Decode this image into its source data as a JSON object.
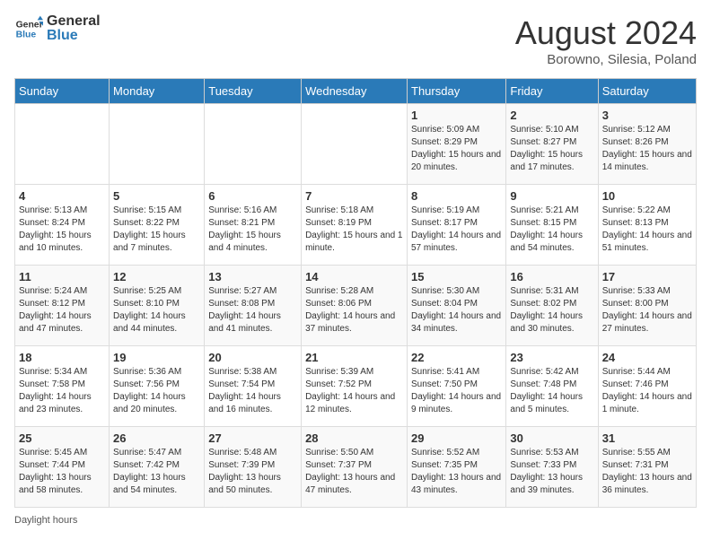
{
  "logo": {
    "general": "General",
    "blue": "Blue"
  },
  "header": {
    "title": "August 2024",
    "subtitle": "Borowno, Silesia, Poland"
  },
  "days_of_week": [
    "Sunday",
    "Monday",
    "Tuesday",
    "Wednesday",
    "Thursday",
    "Friday",
    "Saturday"
  ],
  "weeks": [
    [
      {
        "day": "",
        "sunrise": "",
        "sunset": "",
        "daylight": "",
        "empty": true
      },
      {
        "day": "",
        "sunrise": "",
        "sunset": "",
        "daylight": "",
        "empty": true
      },
      {
        "day": "",
        "sunrise": "",
        "sunset": "",
        "daylight": "",
        "empty": true
      },
      {
        "day": "",
        "sunrise": "",
        "sunset": "",
        "daylight": "",
        "empty": true
      },
      {
        "day": "1",
        "sunrise": "5:09 AM",
        "sunset": "8:29 PM",
        "daylight": "15 hours and 20 minutes."
      },
      {
        "day": "2",
        "sunrise": "5:10 AM",
        "sunset": "8:27 PM",
        "daylight": "15 hours and 17 minutes."
      },
      {
        "day": "3",
        "sunrise": "5:12 AM",
        "sunset": "8:26 PM",
        "daylight": "15 hours and 14 minutes."
      }
    ],
    [
      {
        "day": "4",
        "sunrise": "5:13 AM",
        "sunset": "8:24 PM",
        "daylight": "15 hours and 10 minutes."
      },
      {
        "day": "5",
        "sunrise": "5:15 AM",
        "sunset": "8:22 PM",
        "daylight": "15 hours and 7 minutes."
      },
      {
        "day": "6",
        "sunrise": "5:16 AM",
        "sunset": "8:21 PM",
        "daylight": "15 hours and 4 minutes."
      },
      {
        "day": "7",
        "sunrise": "5:18 AM",
        "sunset": "8:19 PM",
        "daylight": "15 hours and 1 minute."
      },
      {
        "day": "8",
        "sunrise": "5:19 AM",
        "sunset": "8:17 PM",
        "daylight": "14 hours and 57 minutes."
      },
      {
        "day": "9",
        "sunrise": "5:21 AM",
        "sunset": "8:15 PM",
        "daylight": "14 hours and 54 minutes."
      },
      {
        "day": "10",
        "sunrise": "5:22 AM",
        "sunset": "8:13 PM",
        "daylight": "14 hours and 51 minutes."
      }
    ],
    [
      {
        "day": "11",
        "sunrise": "5:24 AM",
        "sunset": "8:12 PM",
        "daylight": "14 hours and 47 minutes."
      },
      {
        "day": "12",
        "sunrise": "5:25 AM",
        "sunset": "8:10 PM",
        "daylight": "14 hours and 44 minutes."
      },
      {
        "day": "13",
        "sunrise": "5:27 AM",
        "sunset": "8:08 PM",
        "daylight": "14 hours and 41 minutes."
      },
      {
        "day": "14",
        "sunrise": "5:28 AM",
        "sunset": "8:06 PM",
        "daylight": "14 hours and 37 minutes."
      },
      {
        "day": "15",
        "sunrise": "5:30 AM",
        "sunset": "8:04 PM",
        "daylight": "14 hours and 34 minutes."
      },
      {
        "day": "16",
        "sunrise": "5:31 AM",
        "sunset": "8:02 PM",
        "daylight": "14 hours and 30 minutes."
      },
      {
        "day": "17",
        "sunrise": "5:33 AM",
        "sunset": "8:00 PM",
        "daylight": "14 hours and 27 minutes."
      }
    ],
    [
      {
        "day": "18",
        "sunrise": "5:34 AM",
        "sunset": "7:58 PM",
        "daylight": "14 hours and 23 minutes."
      },
      {
        "day": "19",
        "sunrise": "5:36 AM",
        "sunset": "7:56 PM",
        "daylight": "14 hours and 20 minutes."
      },
      {
        "day": "20",
        "sunrise": "5:38 AM",
        "sunset": "7:54 PM",
        "daylight": "14 hours and 16 minutes."
      },
      {
        "day": "21",
        "sunrise": "5:39 AM",
        "sunset": "7:52 PM",
        "daylight": "14 hours and 12 minutes."
      },
      {
        "day": "22",
        "sunrise": "5:41 AM",
        "sunset": "7:50 PM",
        "daylight": "14 hours and 9 minutes."
      },
      {
        "day": "23",
        "sunrise": "5:42 AM",
        "sunset": "7:48 PM",
        "daylight": "14 hours and 5 minutes."
      },
      {
        "day": "24",
        "sunrise": "5:44 AM",
        "sunset": "7:46 PM",
        "daylight": "14 hours and 1 minute."
      }
    ],
    [
      {
        "day": "25",
        "sunrise": "5:45 AM",
        "sunset": "7:44 PM",
        "daylight": "13 hours and 58 minutes."
      },
      {
        "day": "26",
        "sunrise": "5:47 AM",
        "sunset": "7:42 PM",
        "daylight": "13 hours and 54 minutes."
      },
      {
        "day": "27",
        "sunrise": "5:48 AM",
        "sunset": "7:39 PM",
        "daylight": "13 hours and 50 minutes."
      },
      {
        "day": "28",
        "sunrise": "5:50 AM",
        "sunset": "7:37 PM",
        "daylight": "13 hours and 47 minutes."
      },
      {
        "day": "29",
        "sunrise": "5:52 AM",
        "sunset": "7:35 PM",
        "daylight": "13 hours and 43 minutes."
      },
      {
        "day": "30",
        "sunrise": "5:53 AM",
        "sunset": "7:33 PM",
        "daylight": "13 hours and 39 minutes."
      },
      {
        "day": "31",
        "sunrise": "5:55 AM",
        "sunset": "7:31 PM",
        "daylight": "13 hours and 36 minutes."
      }
    ]
  ],
  "footer": {
    "daylight_label": "Daylight hours"
  }
}
